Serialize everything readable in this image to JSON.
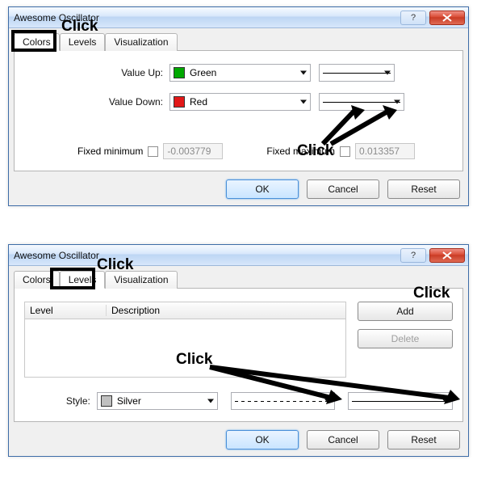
{
  "dialog1": {
    "title": "Awesome Oscillator",
    "tabs": {
      "colors": "Colors",
      "levels": "Levels",
      "visualization": "Visualization"
    },
    "value_up_label": "Value Up:",
    "value_up_color": "Green",
    "value_down_label": "Value Down:",
    "value_down_color": "Red",
    "fixed_min_label": "Fixed minimum",
    "fixed_min_value": "-0.003779",
    "fixed_max_label": "Fixed maximum",
    "fixed_max_value": "0.013357",
    "ok": "OK",
    "cancel": "Cancel",
    "reset": "Reset"
  },
  "dialog2": {
    "title": "Awesome Oscillator",
    "tabs": {
      "colors": "Colors",
      "levels": "Levels",
      "visualization": "Visualization"
    },
    "col_level": "Level",
    "col_description": "Description",
    "add": "Add",
    "delete": "Delete",
    "style_label": "Style:",
    "style_color": "Silver",
    "ok": "OK",
    "cancel": "Cancel",
    "reset": "Reset"
  },
  "annotations": {
    "click": "Click"
  }
}
